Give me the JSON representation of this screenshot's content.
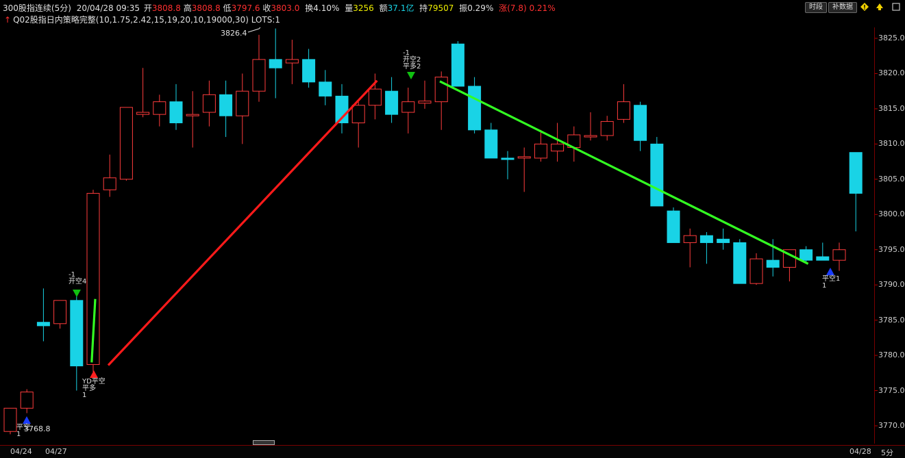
{
  "header": {
    "instrument": "300股指连续(5分)",
    "datetime": "20/04/28 09:35",
    "open_label": "开",
    "open": "3808.8",
    "high_label": "高",
    "high": "3808.8",
    "low_label": "低",
    "low": "3797.6",
    "close_label": "收",
    "close": "3803.0",
    "turnover_label": "换",
    "turnover": "4.10%",
    "volume_label": "量",
    "volume": "3256",
    "amount_label": "额",
    "amount": "37.1亿",
    "oi_label": "持",
    "oi": "79507",
    "amp_label": "振",
    "amp": "0.29%",
    "chg_label": "涨",
    "chg": "(7.8)",
    "chg_pct": "0.21%"
  },
  "strategy_line": "Q02股指日内策略完整(10,1.75,2.42,15,19,20,10,19000,30) LOTS:1",
  "toolbar": {
    "timeframe_button": "时段",
    "supplement_button": "补数据"
  },
  "y_axis": {
    "min": 3768,
    "max": 3827,
    "ticks": [
      3825.0,
      3820.0,
      3815.0,
      3810.0,
      3805.0,
      3800.0,
      3795.0,
      3790.0,
      3785.0,
      3780.0,
      3775.0,
      3770.0
    ]
  },
  "x_axis": {
    "labels": [
      "04/24",
      "04/27",
      "04/28"
    ],
    "period_label": "5分"
  },
  "annotations": {
    "high_mark": "3826.4",
    "low_mark": "3768.8"
  },
  "signals": [
    {
      "text": "-1\n开空4",
      "bar": 4,
      "type": "short-open"
    },
    {
      "text": "YD平空\n平多\n1",
      "bar": 5,
      "type": "close"
    },
    {
      "text": "-1\n开空2\n平多2",
      "bar": 24,
      "type": "short-open"
    },
    {
      "text": "平空1\n1",
      "bar": 49,
      "type": "close-short"
    },
    {
      "text": "平空\n1",
      "bar": 1,
      "type": "close-short"
    }
  ],
  "colors": {
    "up": "#ff3c3c",
    "down": "#19d3e6",
    "trend_up": "#ff1a1a",
    "trend_down": "#33ff22",
    "axis": "#7a0000"
  },
  "chart_data": {
    "type": "candlestick",
    "bars": [
      {
        "o": 3769.2,
        "h": 3772.0,
        "l": 3768.8,
        "c": 3772.5
      },
      {
        "o": 3772.5,
        "h": 3775.2,
        "l": 3771.8,
        "c": 3774.8
      },
      {
        "o": 3784.7,
        "h": 3789.5,
        "l": 3782.0,
        "c": 3784.2
      },
      {
        "o": 3784.5,
        "h": 3787.8,
        "l": 3783.8,
        "c": 3787.8
      },
      {
        "o": 3787.8,
        "h": 3788.8,
        "l": 3775.0,
        "c": 3778.5
      },
      {
        "o": 3778.7,
        "h": 3803.5,
        "l": 3777.5,
        "c": 3803.0
      },
      {
        "o": 3803.5,
        "h": 3808.5,
        "l": 3802.5,
        "c": 3805.2
      },
      {
        "o": 3805.0,
        "h": 3815.2,
        "l": 3804.8,
        "c": 3815.2
      },
      {
        "o": 3814.2,
        "h": 3820.8,
        "l": 3813.8,
        "c": 3814.5
      },
      {
        "o": 3814.2,
        "h": 3817.0,
        "l": 3812.5,
        "c": 3816.0
      },
      {
        "o": 3816.0,
        "h": 3818.5,
        "l": 3812.0,
        "c": 3813.0
      },
      {
        "o": 3814.0,
        "h": 3817.5,
        "l": 3809.5,
        "c": 3814.2
      },
      {
        "o": 3814.5,
        "h": 3819.0,
        "l": 3812.5,
        "c": 3817.0
      },
      {
        "o": 3817.0,
        "h": 3819.0,
        "l": 3811.0,
        "c": 3814.0
      },
      {
        "o": 3814.0,
        "h": 3820.0,
        "l": 3810.0,
        "c": 3817.5
      },
      {
        "o": 3817.5,
        "h": 3825.5,
        "l": 3816.0,
        "c": 3822.0
      },
      {
        "o": 3822.0,
        "h": 3826.4,
        "l": 3816.5,
        "c": 3820.8
      },
      {
        "o": 3821.5,
        "h": 3824.8,
        "l": 3818.5,
        "c": 3822.0
      },
      {
        "o": 3822.0,
        "h": 3823.5,
        "l": 3818.0,
        "c": 3818.8
      },
      {
        "o": 3818.8,
        "h": 3820.5,
        "l": 3815.5,
        "c": 3816.8
      },
      {
        "o": 3816.8,
        "h": 3818.5,
        "l": 3811.5,
        "c": 3813.0
      },
      {
        "o": 3813.0,
        "h": 3816.0,
        "l": 3809.5,
        "c": 3815.5
      },
      {
        "o": 3815.5,
        "h": 3820.0,
        "l": 3813.5,
        "c": 3817.8
      },
      {
        "o": 3817.5,
        "h": 3819.5,
        "l": 3813.0,
        "c": 3814.2
      },
      {
        "o": 3814.5,
        "h": 3818.0,
        "l": 3811.5,
        "c": 3816.0
      },
      {
        "o": 3815.8,
        "h": 3819.0,
        "l": 3815.0,
        "c": 3816.1
      },
      {
        "o": 3816.0,
        "h": 3820.3,
        "l": 3812.0,
        "c": 3819.5
      },
      {
        "o": 3824.2,
        "h": 3824.6,
        "l": 3818.5,
        "c": 3818.2
      },
      {
        "o": 3818.2,
        "h": 3819.5,
        "l": 3811.5,
        "c": 3812.0
      },
      {
        "o": 3812.0,
        "h": 3813.0,
        "l": 3808.0,
        "c": 3808.0
      },
      {
        "o": 3808.0,
        "h": 3809.0,
        "l": 3805.0,
        "c": 3807.8
      },
      {
        "o": 3808.0,
        "h": 3809.5,
        "l": 3803.2,
        "c": 3808.2
      },
      {
        "o": 3808.0,
        "h": 3812.0,
        "l": 3807.5,
        "c": 3810.0
      },
      {
        "o": 3809.0,
        "h": 3813.0,
        "l": 3807.5,
        "c": 3810.0
      },
      {
        "o": 3809.5,
        "h": 3812.5,
        "l": 3807.5,
        "c": 3811.3
      },
      {
        "o": 3811.0,
        "h": 3814.5,
        "l": 3810.5,
        "c": 3811.2
      },
      {
        "o": 3811.2,
        "h": 3814.0,
        "l": 3810.5,
        "c": 3813.2
      },
      {
        "o": 3813.5,
        "h": 3818.5,
        "l": 3813.0,
        "c": 3816.0
      },
      {
        "o": 3815.5,
        "h": 3816.0,
        "l": 3809.0,
        "c": 3810.5
      },
      {
        "o": 3810.0,
        "h": 3811.0,
        "l": 3801.2,
        "c": 3801.2
      },
      {
        "o": 3800.5,
        "h": 3801.0,
        "l": 3796.0,
        "c": 3796.0
      },
      {
        "o": 3796.0,
        "h": 3798.0,
        "l": 3792.5,
        "c": 3797.0
      },
      {
        "o": 3797.0,
        "h": 3797.5,
        "l": 3793.0,
        "c": 3796.0
      },
      {
        "o": 3796.5,
        "h": 3798.0,
        "l": 3795.0,
        "c": 3796.0
      },
      {
        "o": 3796.0,
        "h": 3796.5,
        "l": 3790.2,
        "c": 3790.2
      },
      {
        "o": 3790.2,
        "h": 3794.5,
        "l": 3790.0,
        "c": 3793.7
      },
      {
        "o": 3793.5,
        "h": 3796.5,
        "l": 3791.2,
        "c": 3792.5
      },
      {
        "o": 3792.5,
        "h": 3795.0,
        "l": 3790.5,
        "c": 3795.0
      },
      {
        "o": 3795.0,
        "h": 3795.5,
        "l": 3793.2,
        "c": 3793.5
      },
      {
        "o": 3794.0,
        "h": 3796.0,
        "l": 3793.5,
        "c": 3793.5
      },
      {
        "o": 3793.5,
        "h": 3796.0,
        "l": 3792.0,
        "c": 3795.0
      },
      {
        "o": 3808.8,
        "h": 3808.8,
        "l": 3797.6,
        "c": 3803.0
      }
    ],
    "trend_lines": [
      {
        "color": "up",
        "from": {
          "bar": 5,
          "price": 3778.6
        },
        "to": {
          "bar": 22,
          "price": 3819.0
        }
      },
      {
        "color": "down",
        "from": {
          "bar": 25,
          "price": 3818.9
        },
        "to": {
          "bar": 48,
          "price": 3793.0
        }
      },
      {
        "color": "down",
        "from": {
          "bar": 4,
          "price": 3779.0
        },
        "to": {
          "bar": 5,
          "price": 3788.0
        }
      }
    ]
  }
}
